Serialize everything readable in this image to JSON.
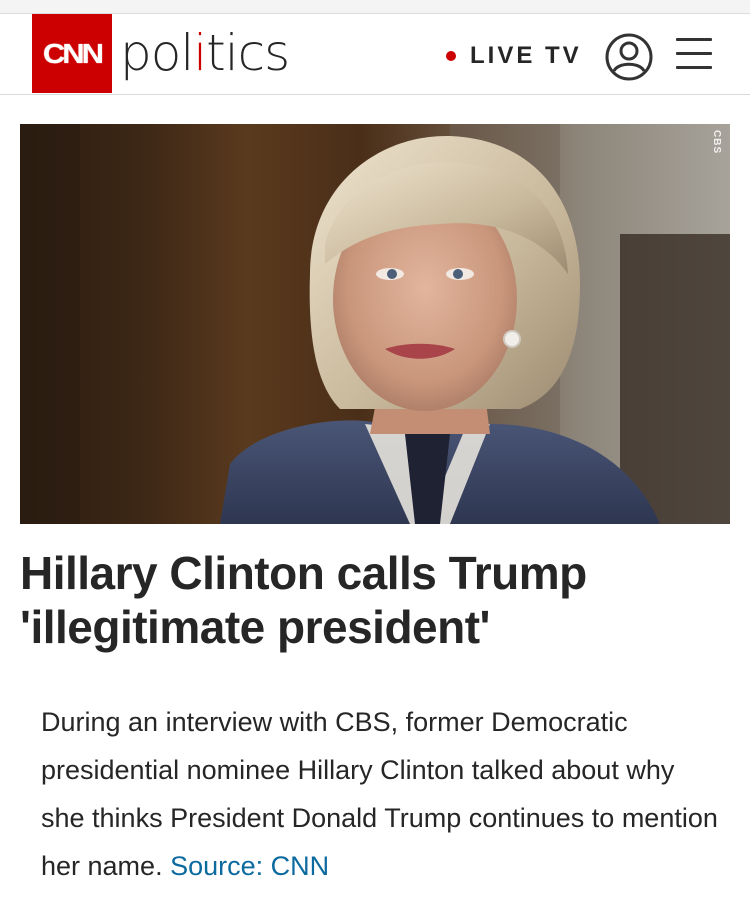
{
  "header": {
    "logo_text": "CNN",
    "section_before": "pol",
    "section_accent": "i",
    "section_after": "tics",
    "live_label": "LIVE TV",
    "user_icon": "user-circle-icon",
    "menu_icon": "hamburger-menu-icon"
  },
  "photo": {
    "alt": "Hillary Clinton during a CBS interview",
    "watermark": "CBS"
  },
  "article": {
    "headline": "Hillary Clinton calls Trump 'illegitimate president'",
    "summary": "During an interview with CBS, former Democratic presidential nominee Hillary Clinton talked about why she thinks President Donald Trump continues to mention her name.",
    "source": "Source: CNN"
  },
  "colors": {
    "brand_red": "#cc0000",
    "text": "#262626",
    "link_blue": "#0c6a9f"
  }
}
